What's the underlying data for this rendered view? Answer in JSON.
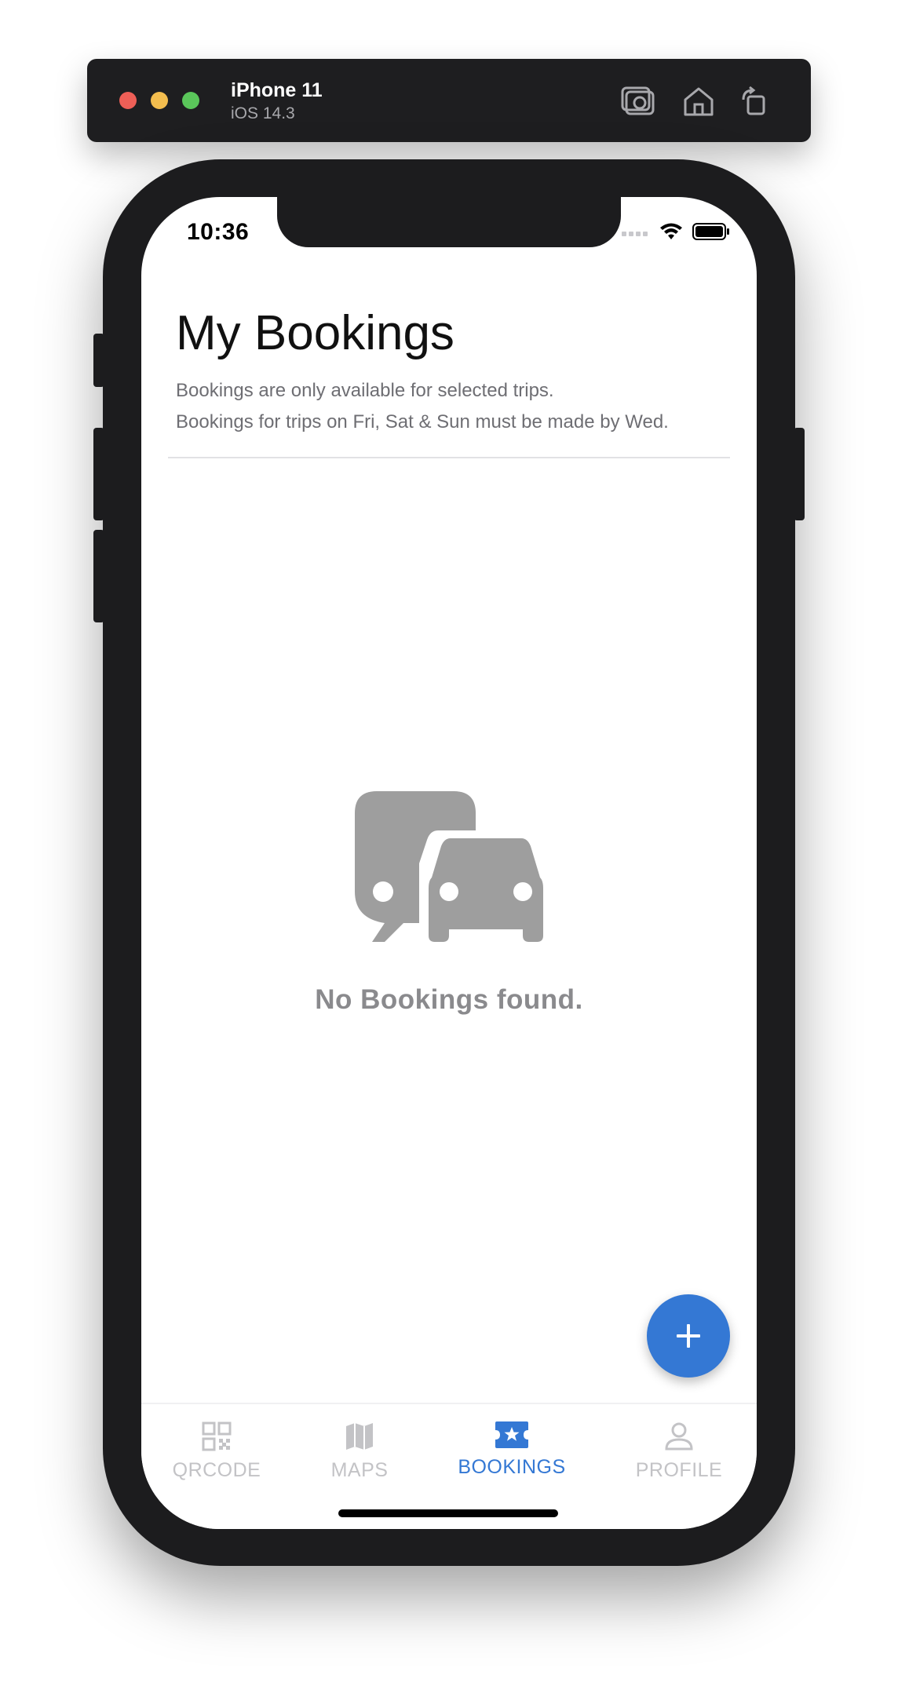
{
  "simulator": {
    "device_name": "iPhone 11",
    "os_version": "iOS 14.3",
    "tools": [
      {
        "icon": "screenshot-icon"
      },
      {
        "icon": "home-icon"
      },
      {
        "icon": "rotate-icon"
      }
    ]
  },
  "status_bar": {
    "time": "10:36",
    "icons": [
      "cellular-icon",
      "wifi-icon",
      "battery-icon"
    ]
  },
  "header": {
    "title": "My Bookings",
    "subtitle_line1": "Bookings are only available for selected trips.",
    "subtitle_line2": "Bookings for trips on Fri, Sat & Sun must be made by Wed."
  },
  "empty_state": {
    "icon": "transport-icon",
    "message": "No Bookings found."
  },
  "fab": {
    "icon": "plus-icon"
  },
  "tabbar": {
    "tabs": [
      {
        "label": "QRCODE",
        "icon": "qrcode-icon",
        "active": false
      },
      {
        "label": "MAPS",
        "icon": "map-icon",
        "active": false
      },
      {
        "label": "BOOKINGS",
        "icon": "ticket-icon",
        "active": true
      },
      {
        "label": "PROFILE",
        "icon": "profile-icon",
        "active": false
      }
    ]
  },
  "colors": {
    "accent": "#3478d4",
    "inactive_tab": "#c3c3c6",
    "empty_icon": "#9e9e9e",
    "device_frame": "#1c1c1e"
  }
}
